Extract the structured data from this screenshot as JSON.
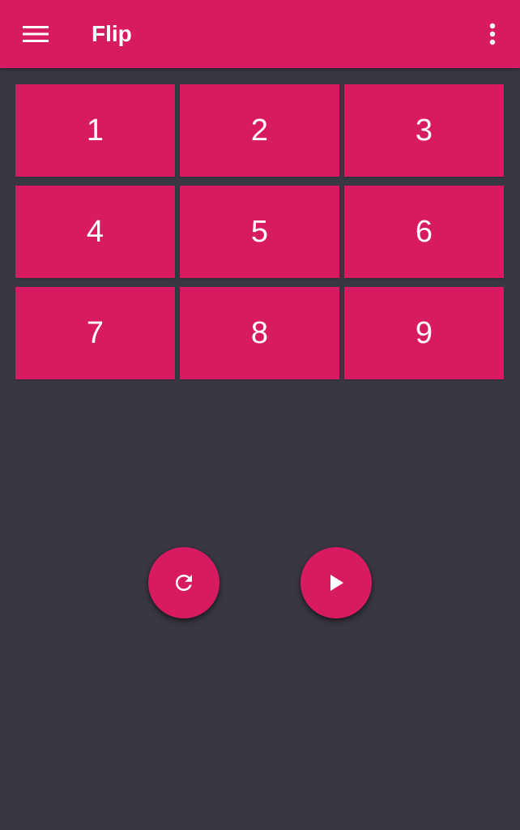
{
  "app_bar": {
    "title": "Flip",
    "menu_icon": "hamburger-menu-icon",
    "overflow_icon": "more-vertical-icon",
    "color": "#d81b60"
  },
  "grid": {
    "tiles": [
      "1",
      "2",
      "3",
      "4",
      "5",
      "6",
      "7",
      "8",
      "9"
    ],
    "tile_color": "#d81b60"
  },
  "controls": {
    "reset_icon": "refresh-icon",
    "play_icon": "play-icon",
    "accent": "#d81b60"
  },
  "background": "#393842"
}
